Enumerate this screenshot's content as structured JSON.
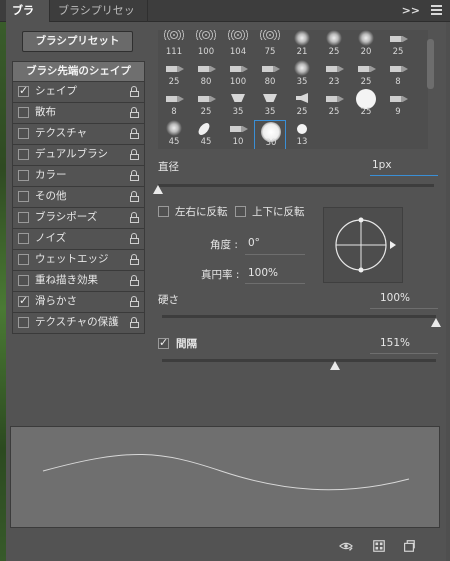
{
  "tabs": [
    {
      "label": "ブラシ",
      "active": true
    },
    {
      "label": "ブラシプリセット",
      "active": false
    }
  ],
  "tab_controls": {
    "collapse": ">>",
    "menu_icon": "hamburger-menu-icon"
  },
  "preset_button": "ブラシプリセット",
  "tip_shape_label": "ブラシ先端のシェイプ",
  "options": [
    {
      "label": "シェイプ",
      "checked": true
    },
    {
      "label": "散布",
      "checked": false
    },
    {
      "label": "テクスチャ",
      "checked": false
    },
    {
      "label": "デュアルブラシ",
      "checked": false
    },
    {
      "label": "カラー",
      "checked": false
    },
    {
      "label": "その他",
      "checked": false
    },
    {
      "label": "ブラシポーズ",
      "checked": false
    },
    {
      "label": "ノイズ",
      "checked": false
    },
    {
      "label": "ウェットエッジ",
      "checked": false
    },
    {
      "label": "重ね描き効果",
      "checked": false
    },
    {
      "label": "滑らかさ",
      "checked": true
    },
    {
      "label": "テクスチャの保護",
      "checked": false
    }
  ],
  "brush_sizes": [
    [
      "111",
      "100",
      "104",
      "75",
      "21",
      "25",
      "20",
      "25"
    ],
    [
      "25",
      "80",
      "100",
      "80",
      "35",
      "23",
      "25",
      "8"
    ],
    [
      "8",
      "25",
      "35",
      "35",
      "25",
      "25",
      "25",
      "9"
    ],
    [
      "45",
      "45",
      "10",
      "30",
      "13"
    ]
  ],
  "selected_brush": "30",
  "diameter": {
    "label": "直径",
    "value": "1px"
  },
  "flip_x": {
    "label": "左右に反転",
    "checked": false
  },
  "flip_y": {
    "label": "上下に反転",
    "checked": false
  },
  "angle": {
    "label": "角度 :",
    "value": "0°"
  },
  "roundness": {
    "label": "真円率 :",
    "value": "100%"
  },
  "hardness": {
    "label": "硬さ",
    "value": "100%",
    "level": 1.0
  },
  "spacing": {
    "label": "間隔",
    "value": "151%",
    "checked": true,
    "level": 0.51
  },
  "diameter_level": 0.0,
  "footer_icons": [
    "eye-protect-icon",
    "grid-panel-icon",
    "new-brush-icon"
  ],
  "colors": {
    "panel": "#535353",
    "accent": "#3a8fd6"
  }
}
